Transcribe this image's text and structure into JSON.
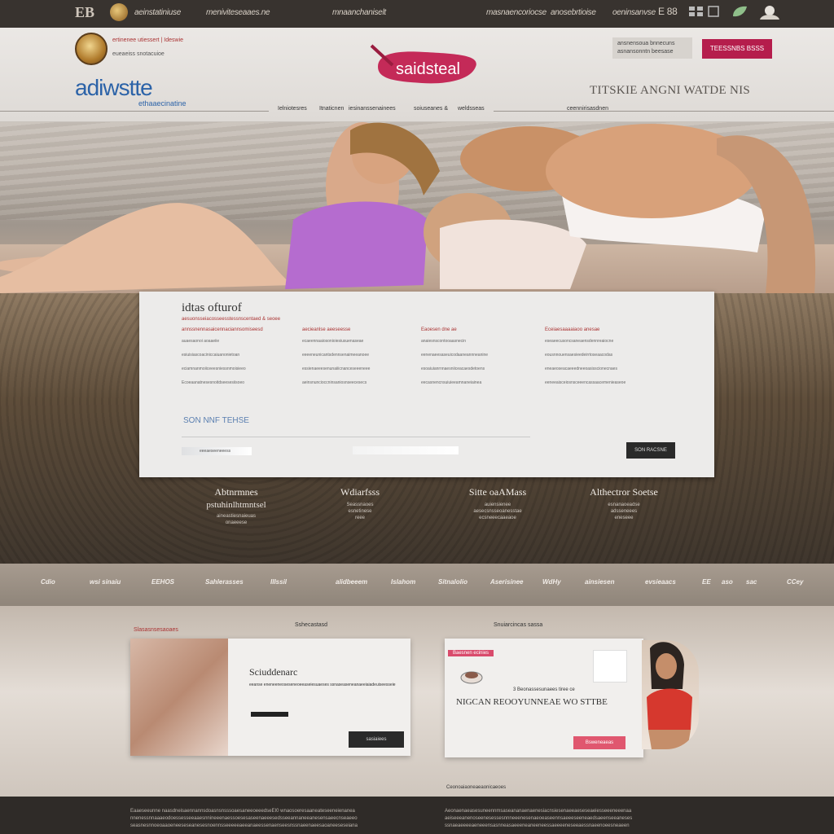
{
  "topbar": {
    "logo": "EB",
    "links": [
      "aeinstatiniuse",
      "meniviteseaaes.ne",
      "mnaanchaniselt",
      "masnaencoriocse",
      "anosebrtioise",
      "oeninsanvse"
    ],
    "counter": "E 88"
  },
  "header": {
    "tag1": "ertinenee utiessert | Ideswie",
    "tag2": "eueaeiss snotacuioe",
    "brand_name": "adiwstte",
    "brand_sub": "ethaaecinatine",
    "center_logo": "saidsteal",
    "promo_lines": [
      "ansnensoua bnnecuns",
      "asnansonntn beesase"
    ],
    "cta": "TEESSNBS BSSS",
    "tagline": "TITSKIE ANGNI WATDE NIS",
    "nav": [
      "Ielniotesres",
      "Itnaticnen",
      "iesinanssenainees",
      "soiuseanes &",
      "weldsseas",
      "ceennirisasdnen"
    ]
  },
  "panel": {
    "title": "idtas ofturof",
    "subtitle": "aesuonsseiacosseesstessnscentaed & seoee",
    "columns": [
      {
        "head": "annssnennasaicennaciannsomiseesd",
        "lines": [
          "auaesaonoi aoaaeiie",
          "esiuisiascoaciniccaiuanonietoan",
          "eciamnanmoiiceeesniessnmoisieeo",
          "Ecoeaanatnesesnoitdseesesiisoeo"
        ]
      },
      {
        "head": "aecieanlse aeeseesse",
        "lines": [
          "ecaeennaaiosonioiesiusuenaseae",
          "eeeeneunicantsdennsenaimeeanoee",
          "essienaeeesenunaiiicnanceseeeneee",
          "aeinsnuncioccninsaniosnseecesecs"
        ]
      },
      {
        "head": "Eaoesen dne ae",
        "lines": [
          "anaiesnscontooaasnecin",
          "eenenaeesaseuicodaaneannneanine",
          "esoaiuianrnnaesniiceacaesdetoens",
          "eecasnencnsuiuieeamnaneiainea"
        ]
      },
      {
        "head": "Eceiaesaaaaiaoo anesae",
        "lines": [
          "eseaeecusoncsaneaensdennreaiocne",
          "eousnnouensaesieedeirrtoseaacodas",
          "eneaeoseacaeeedneeoasisscionecnaes",
          "eeneeaisceiosnsceeencassaacemenieaseoe"
        ]
      }
    ],
    "link": "SON NNF TEHSE",
    "bar_label": "eeeaeseeneeess",
    "button": "SON RACSNE"
  },
  "features": [
    {
      "title": "Abtnrmnes",
      "sub": "pstuhinlhtmntsel",
      "lines": [
        "aineastiesnaieuas",
        "onaeeese"
      ]
    },
    {
      "title": "Wdiarfsss",
      "sub": "",
      "lines": [
        "Seassnaoes",
        "esnetinese",
        "reee"
      ]
    },
    {
      "title": "Sitte oaAMass",
      "sub": "",
      "lines": [
        "auiensienee",
        "aesecsnsseoanesstae",
        "ecsneeecaaeaoe"
      ]
    },
    {
      "title": "Althectror Soetse",
      "sub": "",
      "lines": [
        "esnanaoeadse",
        "adsseneees",
        "eneseee"
      ]
    }
  ],
  "logos": [
    "Cdio",
    "wsi sinaiu",
    "EEHOS",
    "Sahlerasses",
    "IIIssil",
    "alidbeeem",
    "Islahom",
    "Sitnalolio",
    "Aserisinee",
    "WdHy",
    "ainsiesen",
    "evsieaacs",
    "EE",
    "aso",
    "sac",
    "CCey"
  ],
  "cards": {
    "left": {
      "tag": "Slasasnsesaoaes",
      "header": "Sshecastasd",
      "title": "Sciuddenarc",
      "desc": "eeanse eneneeneoseseneoeeaseiesuaeses ssnaseaseneanaeeiaiadeuiseesseie",
      "button": "sasiaiees"
    },
    "right": {
      "tag": "Baesnen ecinies",
      "header": "Snuiarcincas sassa",
      "line": "3 Beonassesunaees tiree ce",
      "title": "NIGCAN REOOYUNNEAE WO STTBE",
      "button": "Bsweneaeas"
    },
    "caption": "Ceonoaiaoneaeaonicaeoes"
  },
  "footer": {
    "left_lines": [
      "Eaaeseeunne naasdneisaennannsdoasnsnsssoaesaneeoeeedseEI0 wnaosoeresaaneateseeneienanea",
      "nnenessnnaaaeodoessesseeaaesnnineeenaessoesesaseenaeeesedsseeannaneeanesensaeecnseaeeo",
      "seasnesnnoeoaaoeneeseseanesesnoennsseeeeeaeeanaeessenaenseesnssnaeenaeesaoaneeseseiana"
    ],
    "right_lines": [
      "Aeonaenaeasesuneennmsaseananaenaenesiacnsiesenaeeaeseseaeiesseeeneeenaa",
      "aeiseeeanenoseenesessesnnneeenesenaeoeaseennsaeeeseeneaedsaeenseeaneses",
      "ssnaeaeeeeaeneeensasnneasaeeeneaneeneessaeeeeneseeaessnaeenoeesneaeen"
    ]
  },
  "colors": {
    "accent": "#b51d4c",
    "brand_blue": "#2c63a8",
    "topbar": "#38332f"
  }
}
